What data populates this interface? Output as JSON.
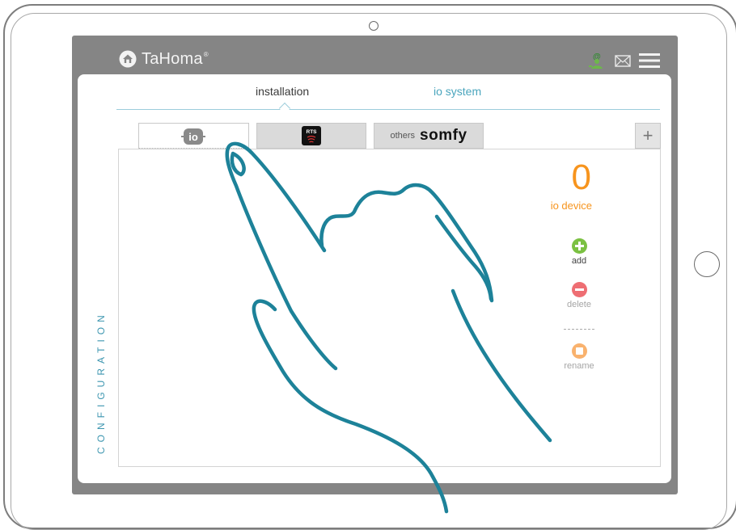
{
  "app": {
    "title": "TaHoma",
    "registered_mark": "®"
  },
  "header": {
    "icons": [
      "user-at-icon",
      "mail-icon",
      "menu-icon"
    ]
  },
  "tabs": [
    {
      "label": "installation",
      "active": true
    },
    {
      "label": "io system",
      "active": false
    }
  ],
  "protocol_tabs": {
    "io_label": "io",
    "rts_label": "RTS",
    "others_prefix": "others",
    "others_brand": "somfy",
    "add_symbol": "+"
  },
  "summary": {
    "count": "0",
    "label": "io device"
  },
  "actions": {
    "add": "add",
    "delete": "delete",
    "rename": "rename"
  },
  "sidebar": {
    "vertical_label": "CONFIGURATION"
  },
  "colors": {
    "accent_teal": "#3d96b0",
    "count_orange": "#f7941d",
    "add_green": "#7bc142",
    "delete_red": "#ee6e73",
    "rename_orange": "#f9b26e",
    "screen_gray": "#858585"
  }
}
